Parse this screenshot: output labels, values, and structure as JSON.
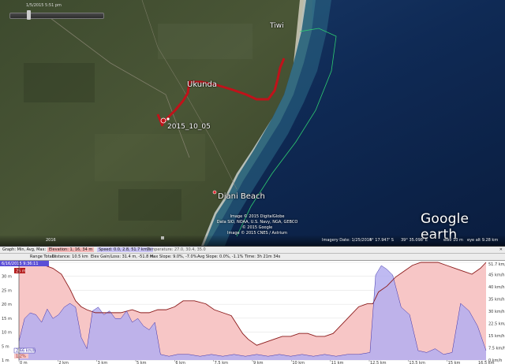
{
  "map": {
    "timestamp": "1/5/2015 5:51 pm",
    "places": {
      "tiwi": "Tiwi",
      "ukunda": "Ukunda",
      "diani_beach": "Diani Beach"
    },
    "route_label": "2015_10_05",
    "attribution": [
      "Image © 2015 DigitalGlobe",
      "Data SIO, NOAA, U.S. Navy, NGA, GEBCO",
      "© 2015 Google",
      "Image © 2015 CNES / Astrium"
    ],
    "logo": "Google earth",
    "scale_indicator": "2016",
    "status": {
      "imagery_date": "Imagery Date: 1/25/2015",
      "latitude": "4° 17.947' S",
      "longitude": "39° 35.098' E",
      "elevation": "elev 10 m",
      "eye_alt": "eye alt 9.28 km"
    }
  },
  "profile": {
    "row1": {
      "graph": "Graph: Min, Avg, Max:",
      "elevation": "Elevation: 1, 16, 34 m",
      "speed": "Speed: 0.0, 2.8, 51.7 km/h",
      "temperature": "Temperature: 27.0, 30.4, 35.0"
    },
    "row2": {
      "range_totals": "Range Totals:",
      "distance": "Distance: 10.5 km",
      "gain_loss": "Elev Gain/Loss: 31.4 m, -51.8 m",
      "max_slope": "Max Slope: 9.0%, -7.0%",
      "avg_slope": "Avg Slope: 0.0%, -1.1%",
      "time": "Time: 3h 21m 34s"
    },
    "start_time": "6/16/2015 9:36:11",
    "cursor_elev": "25 m",
    "cursor_speed": "2.66 km/h",
    "cursor_pct": "1.2%",
    "colors": {
      "elevation_line": "#8b1a1a",
      "elevation_fill": "#f7c6c6",
      "speed_fill": "#b4aef0",
      "speed_line": "#3b2fa8"
    }
  },
  "chart_data": {
    "type": "area",
    "x_unit": "km",
    "x_ticks": [
      "0 m",
      "2 km",
      "3 km",
      "5 km",
      "6 km",
      "7.5 km",
      "9 km",
      "10 km",
      "11 km",
      "12.5 km",
      "13.5 km",
      "15 km",
      "16.5 km"
    ],
    "y_left_ticks": [
      "34 m",
      "30 m",
      "25 m",
      "20 m",
      "15 m",
      "10 m",
      "5 m",
      "1 m"
    ],
    "y_right_ticks": [
      "51.7 km/h",
      "45 km/h",
      "40 km/h",
      "35 km/h",
      "30 km/h",
      "22.5 km/h",
      "15 km/h",
      "7.5 km/h",
      "0 km/h"
    ],
    "ylim_left": [
      1,
      34
    ],
    "ylim_right": [
      0,
      51.7
    ],
    "xlim": [
      0,
      16.5
    ],
    "series": [
      {
        "name": "Elevation",
        "axis": "left",
        "x": [
          0,
          0.3,
          0.6,
          0.9,
          1.2,
          1.5,
          1.8,
          2.0,
          2.2,
          2.4,
          2.7,
          3.0,
          3.3,
          3.6,
          4.0,
          4.3,
          4.6,
          4.9,
          5.2,
          5.5,
          5.8,
          6.2,
          6.6,
          6.9,
          7.2,
          7.5,
          7.7,
          7.9,
          8.1,
          8.4,
          8.7,
          9.0,
          9.3,
          9.6,
          9.9,
          10.2,
          10.5,
          10.8,
          11.1,
          11.4,
          11.7,
          12.0,
          12.3,
          12.5,
          12.7,
          13.0,
          13.3,
          13.6,
          13.9,
          14.2,
          14.5,
          14.8,
          15.1,
          15.4,
          15.7,
          16.0,
          16.3,
          16.5
        ],
        "values": [
          34,
          34,
          33,
          33,
          32,
          30,
          25,
          21,
          19,
          18,
          17,
          17,
          17,
          17,
          18,
          17,
          17,
          18,
          18,
          19,
          21,
          21,
          20,
          18,
          17,
          16,
          13,
          10,
          8,
          6,
          7,
          8,
          9,
          9,
          10,
          10,
          9,
          9,
          10,
          13,
          16,
          19,
          20,
          20,
          24,
          26,
          29,
          31,
          33,
          34,
          34,
          34,
          33,
          32,
          31,
          30,
          32,
          34
        ]
      },
      {
        "name": "Speed",
        "axis": "right",
        "x": [
          0,
          0.2,
          0.4,
          0.6,
          0.8,
          1.0,
          1.2,
          1.4,
          1.6,
          1.8,
          2.0,
          2.2,
          2.4,
          2.6,
          2.8,
          3.0,
          3.2,
          3.4,
          3.6,
          3.8,
          4.0,
          4.2,
          4.4,
          4.6,
          4.8,
          5.0,
          5.3,
          5.6,
          6.0,
          6.4,
          6.8,
          7.2,
          7.6,
          8.0,
          8.4,
          8.8,
          9.2,
          9.6,
          10.0,
          10.4,
          10.8,
          11.2,
          11.6,
          12.0,
          12.4,
          12.6,
          12.8,
          13.0,
          13.2,
          13.5,
          13.8,
          14.1,
          14.4,
          14.7,
          15.0,
          15.3,
          15.6,
          15.9,
          16.2,
          16.5
        ],
        "values": [
          10,
          22,
          25,
          24,
          20,
          27,
          22,
          24,
          28,
          30,
          28,
          12,
          6,
          26,
          28,
          24,
          26,
          22,
          22,
          26,
          20,
          22,
          18,
          16,
          20,
          3,
          2,
          3,
          3,
          2,
          3,
          2,
          3,
          2,
          3,
          2,
          3,
          2,
          3,
          2,
          3,
          2,
          3,
          3,
          4,
          45,
          50,
          48,
          45,
          28,
          24,
          5,
          4,
          6,
          3,
          4,
          30,
          26,
          18,
          5
        ]
      }
    ]
  }
}
